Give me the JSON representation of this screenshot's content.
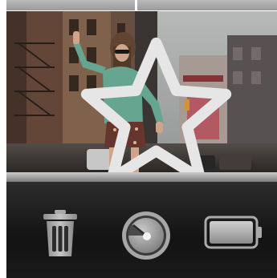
{
  "camera_view": {
    "favorite_icon": "star-outline-icon",
    "settings_icon": "gear-icon"
  },
  "toolbar": {
    "delete_icon": "trash-icon",
    "record_icon": "record-dial-icon",
    "battery_icon": "battery-icon",
    "battery_level": 1.0
  },
  "colors": {
    "toolbar_background": "#1a1a1a",
    "icon_grey": "#a9a9a9",
    "separator": "#9a9a9a"
  }
}
